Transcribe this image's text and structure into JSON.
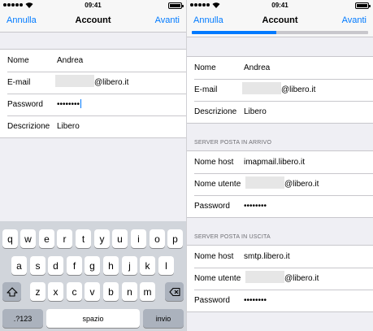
{
  "left": {
    "status": {
      "time": "09:41"
    },
    "nav": {
      "cancel": "Annulla",
      "title": "Account",
      "next": "Avanti"
    },
    "fields": {
      "name": {
        "label": "Nome",
        "value": "Andrea"
      },
      "email": {
        "label": "E-mail",
        "suffix": "@libero.it"
      },
      "password": {
        "label": "Password",
        "value": "••••••••"
      },
      "description": {
        "label": "Descrizione",
        "value": "Libero"
      }
    },
    "keyboard": {
      "row1": [
        "q",
        "w",
        "e",
        "r",
        "t",
        "y",
        "u",
        "i",
        "o",
        "p"
      ],
      "row2": [
        "a",
        "s",
        "d",
        "f",
        "g",
        "h",
        "j",
        "k",
        "l"
      ],
      "row3": [
        "z",
        "x",
        "c",
        "v",
        "b",
        "n",
        "m"
      ],
      "numbers_key": ".?123",
      "space_key": "spazio",
      "return_key": "invio",
      "shift_icon": "shift-arrow-icon",
      "delete_icon": "backspace-icon"
    }
  },
  "right": {
    "status": {
      "time": "09:41"
    },
    "nav": {
      "cancel": "Annulla",
      "title": "Account",
      "next": "Avanti"
    },
    "progress": {
      "fraction": 0.48
    },
    "fields": {
      "name": {
        "label": "Nome",
        "value": "Andrea"
      },
      "email": {
        "label": "E-mail",
        "suffix": "@libero.it"
      },
      "description": {
        "label": "Descrizione",
        "value": "Libero"
      }
    },
    "incoming": {
      "header": "SERVER POSTA IN ARRIVO",
      "host": {
        "label": "Nome host",
        "value": "imapmail.libero.it"
      },
      "user": {
        "label": "Nome utente",
        "suffix": "@libero.it"
      },
      "password": {
        "label": "Password",
        "value": "••••••••"
      }
    },
    "outgoing": {
      "header": "SERVER POSTA IN USCITA",
      "host": {
        "label": "Nome host",
        "value": "smtp.libero.it"
      },
      "user": {
        "label": "Nome utente",
        "suffix": "@libero.it"
      },
      "password": {
        "label": "Password",
        "value": "••••••••"
      }
    }
  },
  "colors": {
    "accent": "#007aff",
    "background": "#efeff4",
    "keyboard": "#d1d5db"
  }
}
